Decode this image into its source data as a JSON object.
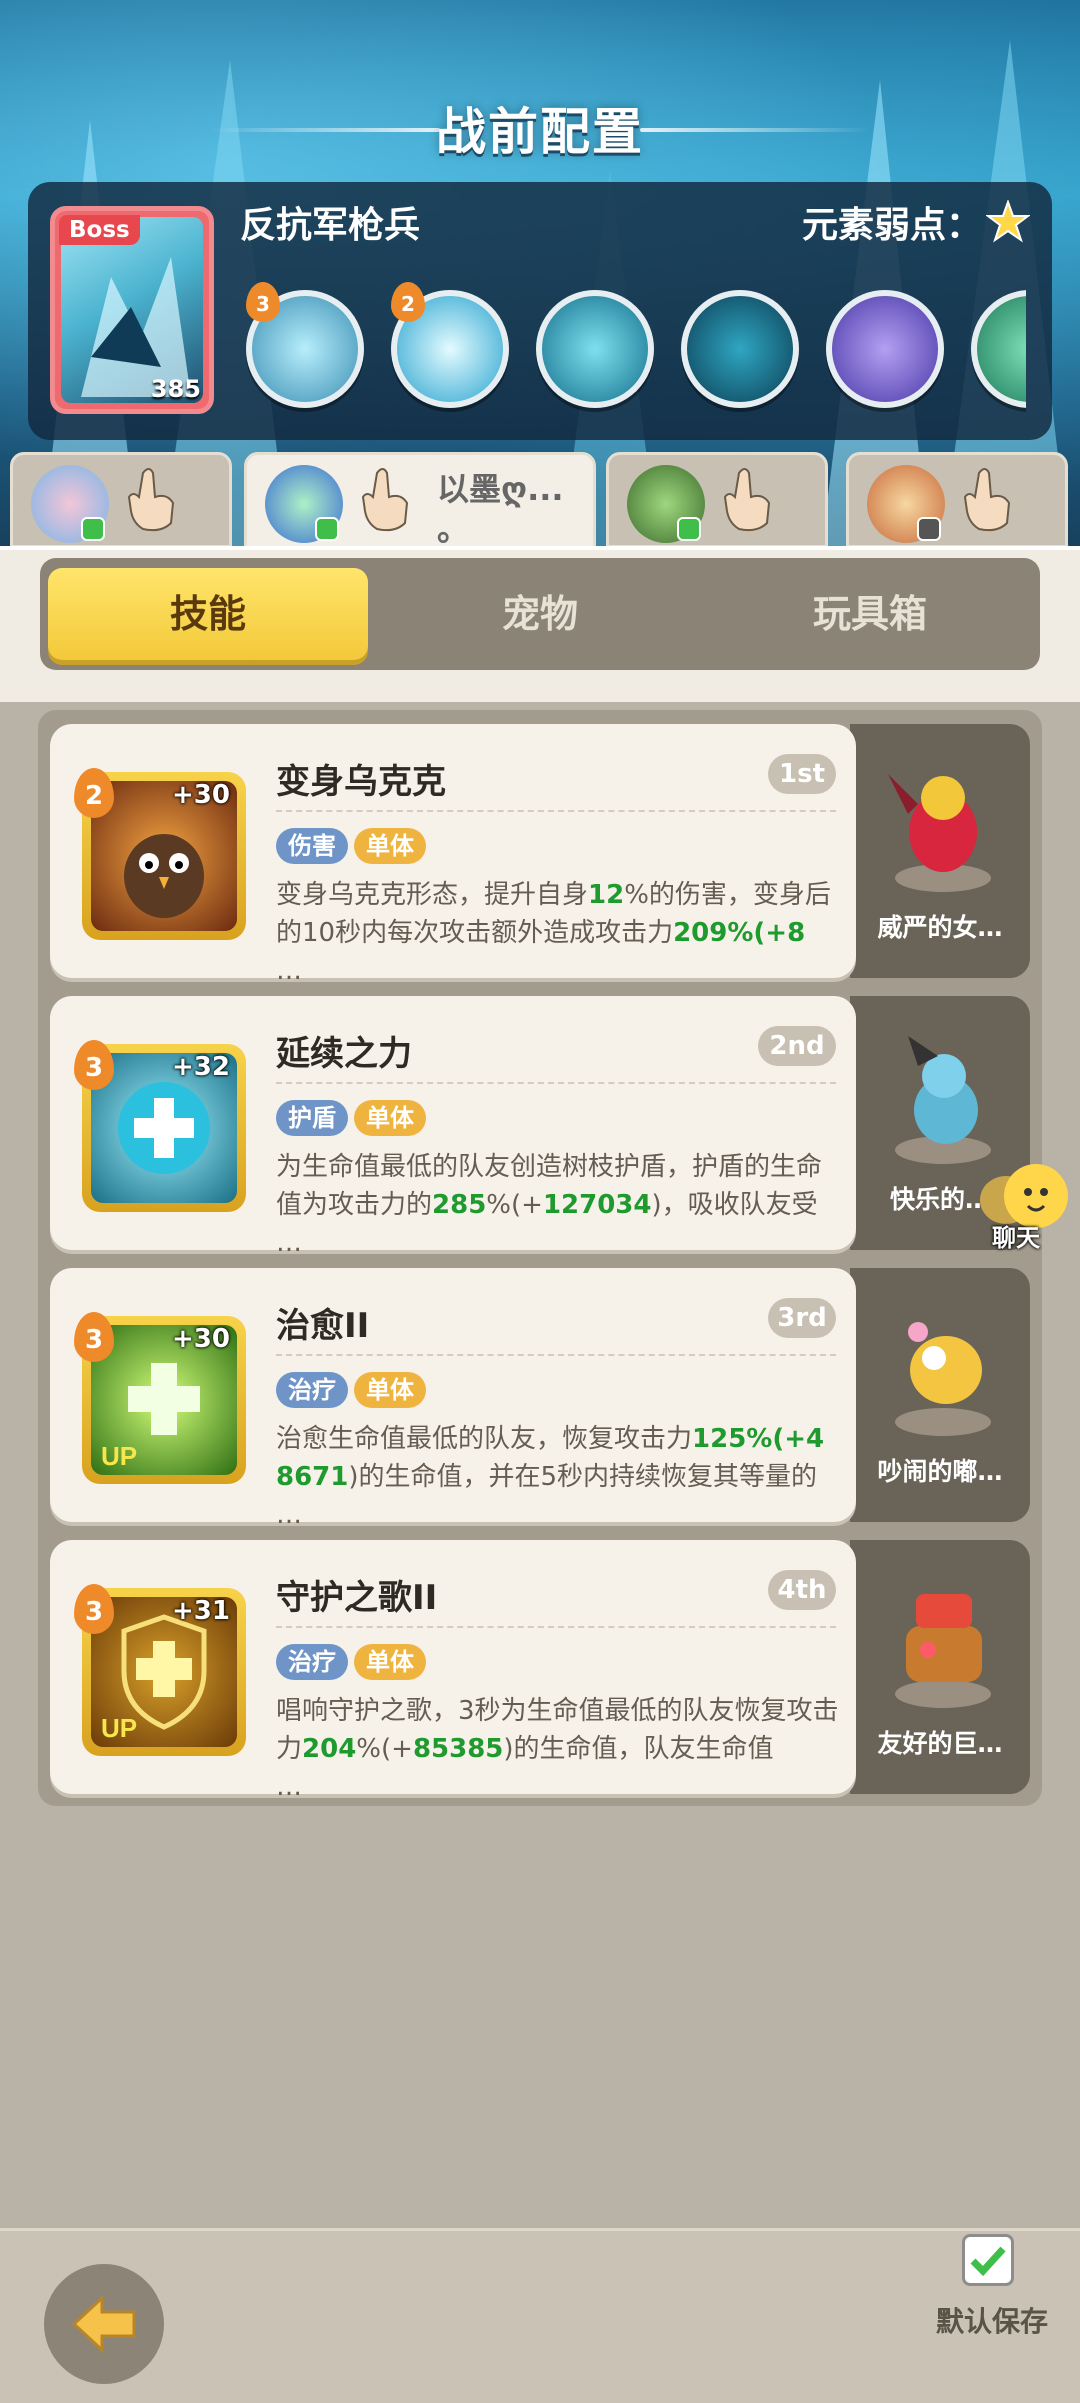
{
  "header": {
    "title": "战前配置"
  },
  "boss": {
    "tag": "Boss",
    "level": "385",
    "name": "反抗军枪兵",
    "weakness_label": "元素弱点：",
    "skills": [
      {
        "badge": "3",
        "icon": "ice-spears-icon"
      },
      {
        "badge": "2",
        "icon": "ice-eye-icon"
      },
      {
        "badge": "",
        "icon": "ice-totem-icon"
      },
      {
        "badge": "",
        "icon": "shadow-beast-icon"
      },
      {
        "badge": "",
        "icon": "purple-ghost-icon"
      }
    ]
  },
  "heroes": [
    {
      "name": "",
      "icon": "hero-avatar-1"
    },
    {
      "name": "以墨ღ...\n。",
      "icon": "hero-avatar-2"
    },
    {
      "name": "",
      "icon": "hero-avatar-3"
    },
    {
      "name": "",
      "icon": "hero-avatar-4"
    }
  ],
  "tabs": {
    "skills": "技能",
    "pets": "宠物",
    "toybox": "玩具箱"
  },
  "skill_cards": [
    {
      "level": "2",
      "plus": "+30",
      "title": "变身乌克克",
      "rank": "1st",
      "tags": [
        "伤害",
        "单体"
      ],
      "desc_parts": [
        "变身乌克克形态，提升自身",
        "12",
        "%的伤害，变身后的10秒内每次攻击额外造成攻击力",
        "209",
        "%(+8",
        "…"
      ],
      "pet": "威严的女…"
    },
    {
      "level": "3",
      "plus": "+32",
      "title": "延续之力",
      "rank": "2nd",
      "tags": [
        "护盾",
        "单体"
      ],
      "desc_parts": [
        "为生命值最低的队友创造树枝护盾，护盾的生命值为攻击力的",
        "285",
        "%(+",
        "127034",
        ")，吸收队友受",
        "…"
      ],
      "pet": "快乐的…"
    },
    {
      "level": "3",
      "plus": "+30",
      "title": "治愈II",
      "rank": "3rd",
      "tags": [
        "治疗",
        "单体"
      ],
      "desc_parts": [
        "治愈生命值最低的队友，恢复攻击力",
        "125",
        "%(+4",
        "8671",
        ")的生命值，并在5秒内持续恢复其等量的",
        "…"
      ],
      "pet": "吵闹的嘟…"
    },
    {
      "level": "3",
      "plus": "+31",
      "title": "守护之歌II",
      "rank": "4th",
      "tags": [
        "治疗",
        "单体"
      ],
      "desc_parts": [
        "唱响守护之歌，3秒为生命值最低的队友恢复攻击力",
        "204",
        "%(+",
        "85385",
        ")的生命值，队友生命值",
        "…"
      ],
      "pet": "友好的巨…"
    }
  ],
  "chat": {
    "label": "聊天"
  },
  "footer": {
    "save_label": "默认保存"
  },
  "colors": {
    "accent_yellow": "#f3c93a",
    "highlight_green": "#1f9a2e",
    "tag_blue": "#6f94c8",
    "tag_orange": "#efb440"
  }
}
